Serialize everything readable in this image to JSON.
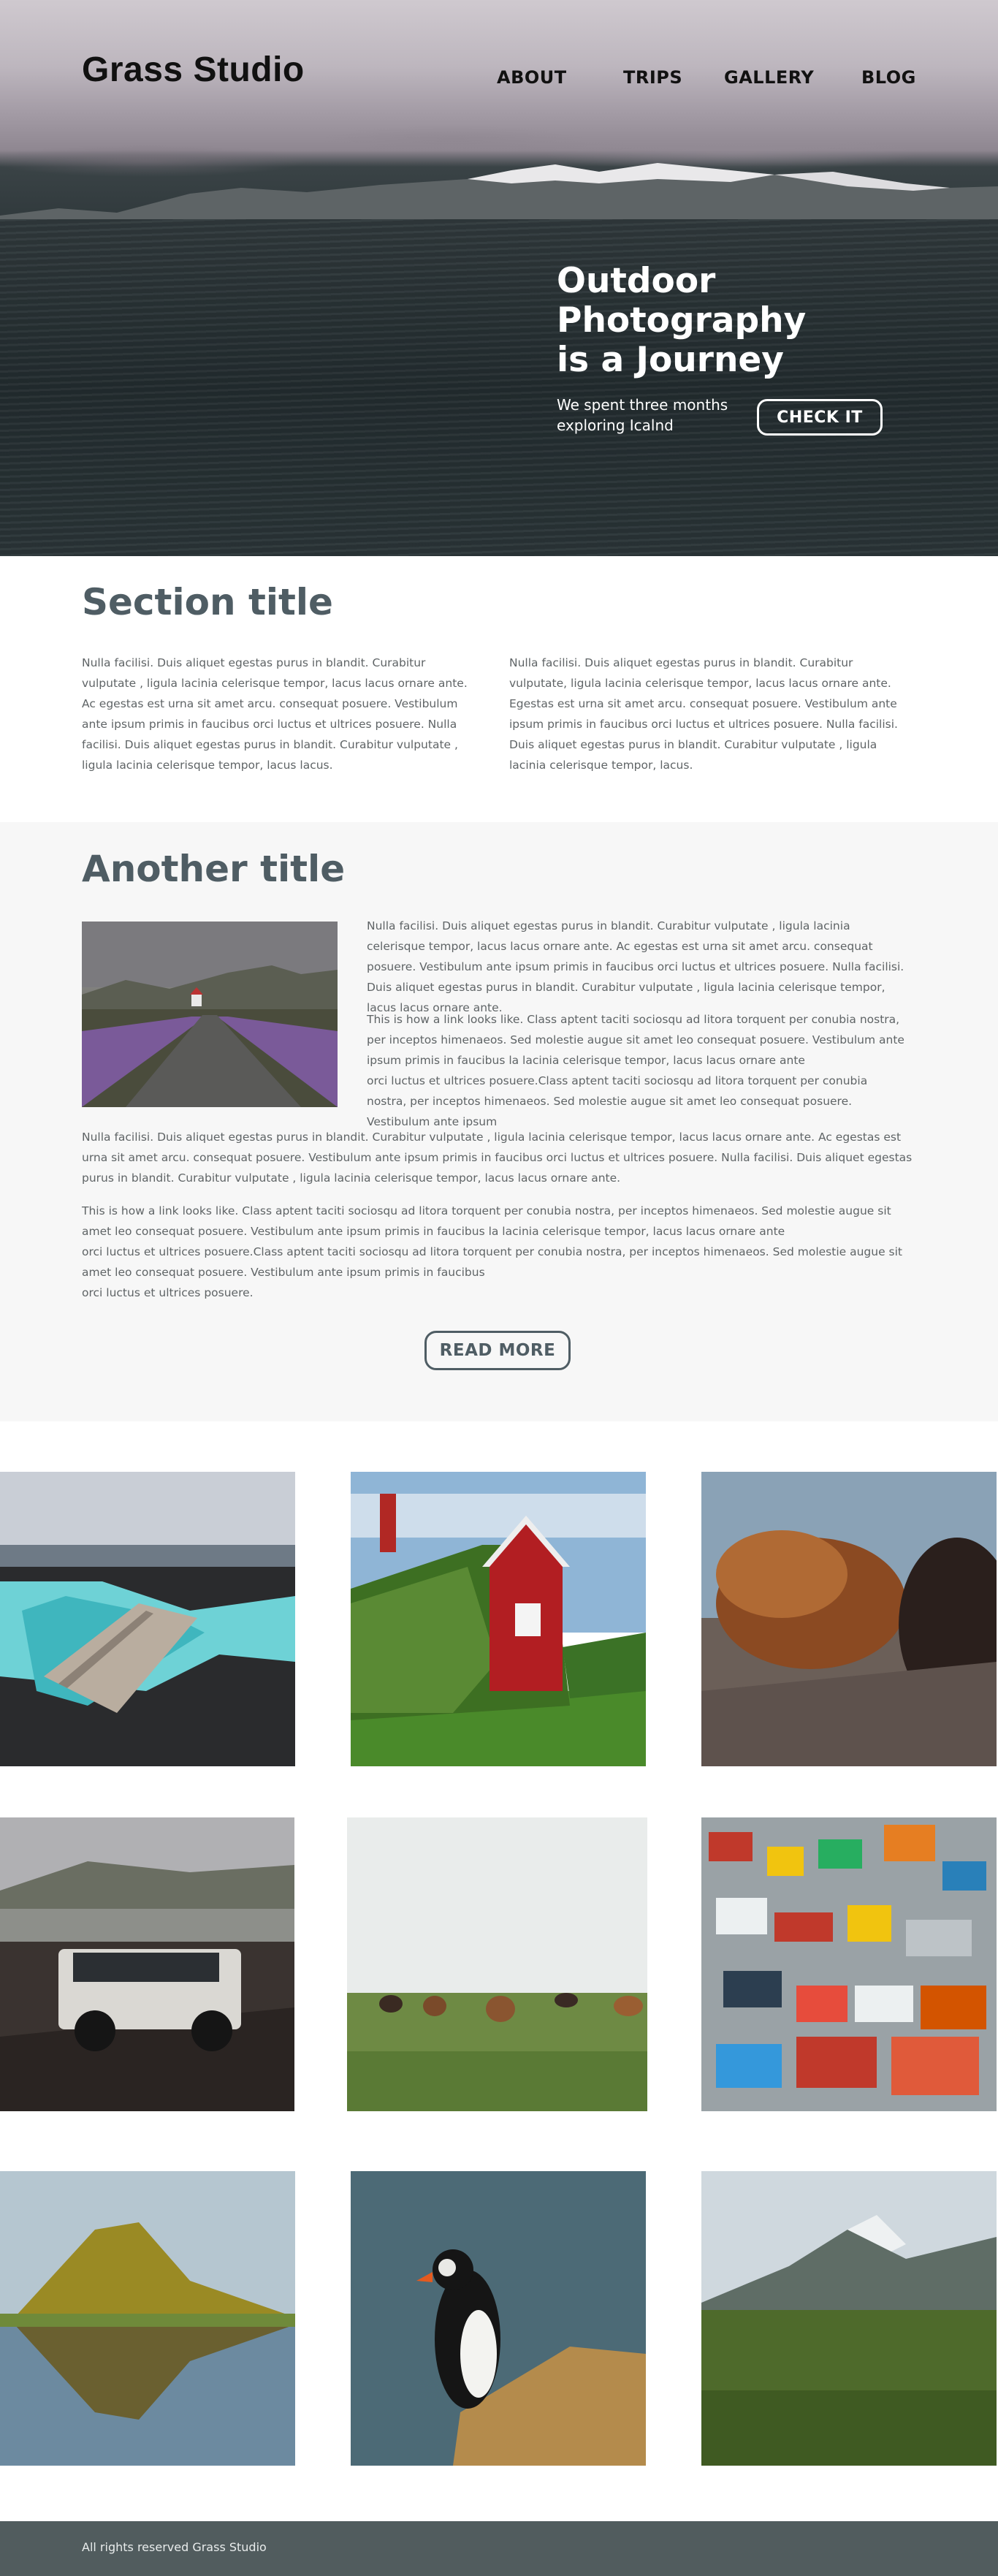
{
  "brand": {
    "logo": "Grass Studio"
  },
  "nav": {
    "items": [
      "ABOUT",
      "TRIPS",
      "GALLERY",
      "BLOG"
    ]
  },
  "hero": {
    "title": "Outdoor\nPhotography\nis a Journey",
    "subtitle": "We spent three months\nexploring Icalnd",
    "cta": "CHECK IT"
  },
  "section1": {
    "title": "Section title",
    "col1": "Nulla facilisi. Duis aliquet egestas purus in blandit. Curabitur vulputate , ligula lacinia celerisque tempor, lacus lacus ornare ante. Ac egestas est urna sit amet arcu. consequat posuere. Vestibulum ante ipsum primis in faucibus orci luctus et ultrices posuere. Nulla facilisi. Duis aliquet egestas purus in blandit. Curabitur vulputate , ligula lacinia celerisque tempor, lacus lacus.",
    "col2": "Nulla facilisi. Duis aliquet egestas purus in blandit. Curabitur vulputate, ligula lacinia celerisque tempor, lacus lacus ornare ante. Egestas est urna sit amet arcu. consequat posuere. Vestibulum ante ipsum primis in faucibus orci luctus et ultrices posuere. Nulla facilisi. Duis aliquet egestas purus in blandit. Curabitur vulputate , ligula lacinia celerisque tempor, lacus."
  },
  "section2": {
    "title": "Another title",
    "p1": "Nulla facilisi. Duis aliquet egestas purus in blandit. Curabitur vulputate , ligula lacinia celerisque tempor, lacus lacus ornare ante. Ac egestas est urna sit amet arcu. consequat posuere. Vestibulum ante ipsum primis in faucibus orci luctus et ultrices posuere. Nulla facilisi. Duis aliquet egestas purus in blandit. Curabitur vulputate , ligula lacinia celerisque tempor, lacus lacus ornare ante.",
    "p2": "This is how a link looks like. Class aptent taciti sociosqu ad litora torquent per conubia nostra, per inceptos himenaeos. Sed molestie augue sit amet leo consequat posuere. Vestibulum ante ipsum primis in faucibus la lacinia celerisque tempor, lacus lacus ornare ante\norci luctus et ultrices posuere.Class aptent taciti sociosqu ad litora torquent per conubia nostra, per inceptos himenaeos. Sed molestie augue sit amet leo consequat posuere. Vestibulum ante ipsum",
    "p3": "Nulla facilisi. Duis aliquet egestas purus in blandit. Curabitur vulputate , ligula lacinia celerisque tempor, lacus lacus ornare ante. Ac egestas est urna sit amet arcu. consequat posuere. Vestibulum ante ipsum primis in faucibus orci luctus et ultrices posuere. Nulla facilisi. Duis aliquet egestas purus in blandit. Curabitur vulputate , ligula lacinia celerisque tempor, lacus lacus ornare ante.",
    "p4": "This is how a link looks like. Class aptent taciti sociosqu ad litora torquent per conubia nostra, per inceptos himenaeos. Sed molestie augue sit amet leo consequat posuere. Vestibulum ante ipsum primis in faucibus la lacinia celerisque tempor, lacus lacus ornare ante\norci luctus et ultrices posuere.Class aptent taciti sociosqu ad litora torquent per conubia nostra, per inceptos himenaeos. Sed molestie augue sit amet leo consequat posuere. Vestibulum ante ipsum primis in faucibus\norci luctus et ultrices posuere.",
    "cta": "READ MORE"
  },
  "gallery": [
    "lagoon-bridge",
    "red-turf-house",
    "horse-mane",
    "off-road-car",
    "horses-field",
    "colorful-town",
    "kirkjufell-mountain",
    "puffin",
    "green-valley"
  ],
  "footer": {
    "text": "All rights reserved  Grass Studio"
  },
  "colors": {
    "title": "#4f5d64",
    "footer": "#515c5e",
    "section_bg": "#f7f7f7"
  }
}
